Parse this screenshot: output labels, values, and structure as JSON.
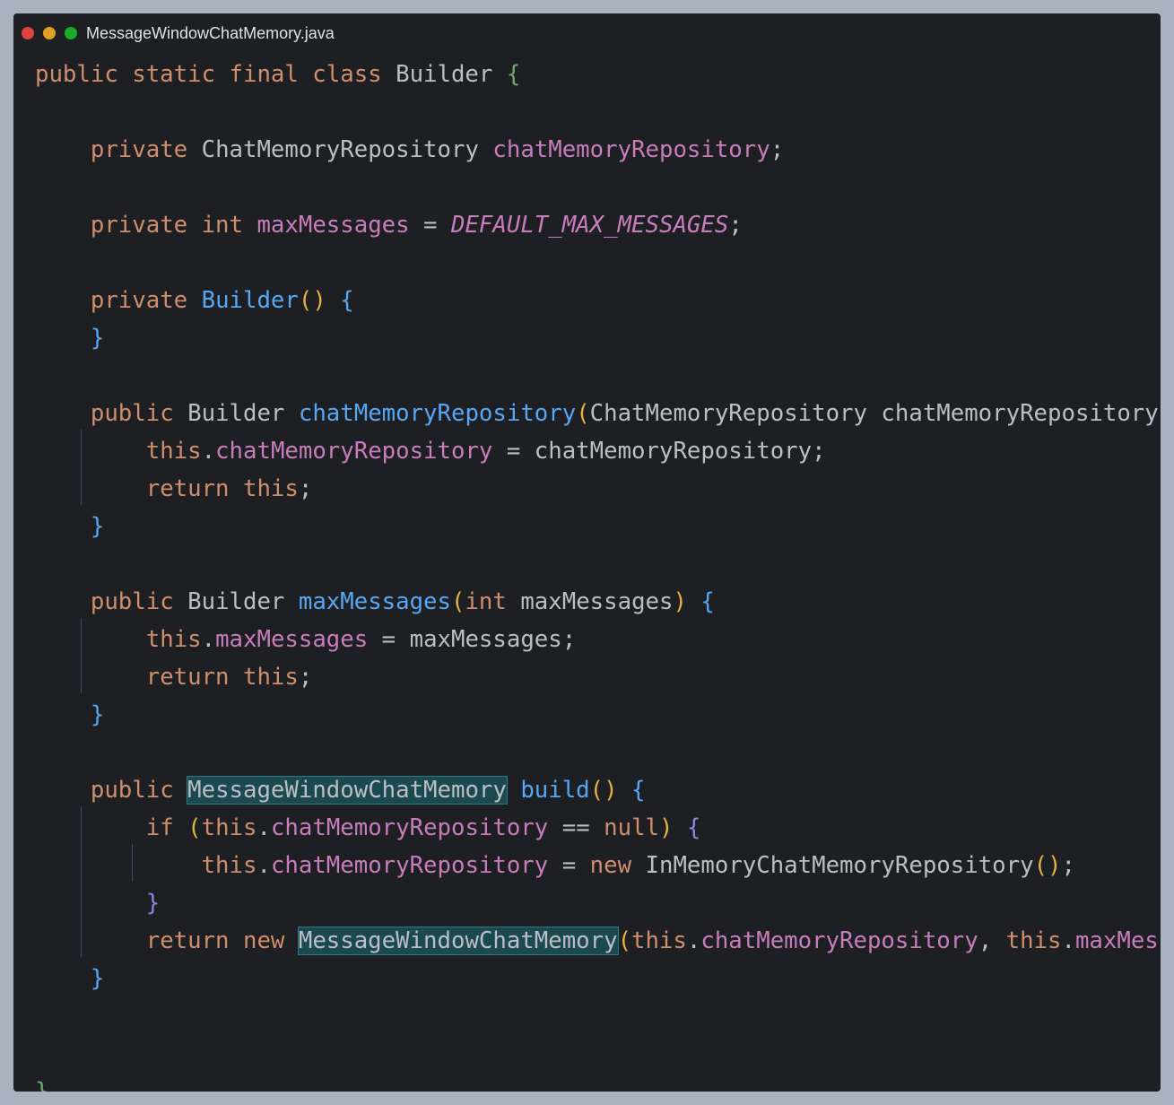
{
  "window": {
    "title": "MessageWindowChatMemory.java",
    "controls": [
      {
        "name": "close",
        "color": "#e0443e"
      },
      {
        "name": "minimize",
        "color": "#dea123"
      },
      {
        "name": "zoom",
        "color": "#1aab29"
      }
    ]
  },
  "code": {
    "language": "java",
    "lines": [
      [
        {
          "t": "public static final class ",
          "c": "kw"
        },
        {
          "t": "Builder "
        },
        {
          "t": "{",
          "c": "bg"
        }
      ],
      [],
      [
        {
          "t": "    "
        },
        {
          "t": "private ",
          "c": "kw"
        },
        {
          "t": "ChatMemoryRepository "
        },
        {
          "t": "chatMemoryRepository",
          "c": "fld"
        },
        {
          "t": ";"
        }
      ],
      [],
      [
        {
          "t": "    "
        },
        {
          "t": "private int ",
          "c": "kw"
        },
        {
          "t": "maxMessages",
          "c": "fld"
        },
        {
          "t": " = "
        },
        {
          "t": "DEFAULT_MAX_MESSAGES",
          "c": "const"
        },
        {
          "t": ";"
        }
      ],
      [],
      [
        {
          "t": "    "
        },
        {
          "t": "private ",
          "c": "kw"
        },
        {
          "t": "Builder",
          "c": "fn"
        },
        {
          "t": "()",
          "c": "py"
        },
        {
          "t": " "
        },
        {
          "t": "{",
          "c": "bl1"
        }
      ],
      [
        {
          "t": "    "
        },
        {
          "t": "}",
          "c": "bl1"
        }
      ],
      [],
      [
        {
          "t": "    "
        },
        {
          "t": "public ",
          "c": "kw"
        },
        {
          "t": "Builder "
        },
        {
          "t": "chatMemoryRepository",
          "c": "fn"
        },
        {
          "t": "(",
          "c": "py"
        },
        {
          "t": "ChatMemoryRepository chatMemoryRepository"
        },
        {
          "t": ")",
          "c": "py"
        },
        {
          "t": " "
        },
        {
          "t": "{",
          "c": "bl1"
        }
      ],
      [
        {
          "t": "        "
        },
        {
          "t": "this",
          "c": "kw"
        },
        {
          "t": "."
        },
        {
          "t": "chatMemoryRepository",
          "c": "fld"
        },
        {
          "t": " = chatMemoryRepository;"
        }
      ],
      [
        {
          "t": "        "
        },
        {
          "t": "return this",
          "c": "kw"
        },
        {
          "t": ";"
        }
      ],
      [
        {
          "t": "    "
        },
        {
          "t": "}",
          "c": "bl1"
        }
      ],
      [],
      [
        {
          "t": "    "
        },
        {
          "t": "public ",
          "c": "kw"
        },
        {
          "t": "Builder "
        },
        {
          "t": "maxMessages",
          "c": "fn"
        },
        {
          "t": "(",
          "c": "py"
        },
        {
          "t": "int ",
          "c": "kw"
        },
        {
          "t": "maxMessages"
        },
        {
          "t": ")",
          "c": "py"
        },
        {
          "t": " "
        },
        {
          "t": "{",
          "c": "bl1"
        }
      ],
      [
        {
          "t": "        "
        },
        {
          "t": "this",
          "c": "kw"
        },
        {
          "t": "."
        },
        {
          "t": "maxMessages",
          "c": "fld"
        },
        {
          "t": " = maxMessages;"
        }
      ],
      [
        {
          "t": "        "
        },
        {
          "t": "return this",
          "c": "kw"
        },
        {
          "t": ";"
        }
      ],
      [
        {
          "t": "    "
        },
        {
          "t": "}",
          "c": "bl1"
        }
      ],
      [],
      [
        {
          "t": "    "
        },
        {
          "t": "public ",
          "c": "kw"
        },
        {
          "t": "MessageWindowChatMemory",
          "c": "hl"
        },
        {
          "t": " "
        },
        {
          "t": "build",
          "c": "fn"
        },
        {
          "t": "()",
          "c": "py"
        },
        {
          "t": " "
        },
        {
          "t": "{",
          "c": "bl1"
        }
      ],
      [
        {
          "t": "        "
        },
        {
          "t": "if ",
          "c": "kw"
        },
        {
          "t": "(",
          "c": "py"
        },
        {
          "t": "this",
          "c": "kw"
        },
        {
          "t": "."
        },
        {
          "t": "chatMemoryRepository",
          "c": "fld"
        },
        {
          "t": " == "
        },
        {
          "t": "null",
          "c": "kw"
        },
        {
          "t": ")",
          "c": "py"
        },
        {
          "t": " "
        },
        {
          "t": "{",
          "c": "pv"
        }
      ],
      [
        {
          "t": "            "
        },
        {
          "t": "this",
          "c": "kw"
        },
        {
          "t": "."
        },
        {
          "t": "chatMemoryRepository",
          "c": "fld"
        },
        {
          "t": " = "
        },
        {
          "t": "new ",
          "c": "kw"
        },
        {
          "t": "InMemoryChatMemoryRepository"
        },
        {
          "t": "()",
          "c": "py"
        },
        {
          "t": ";"
        }
      ],
      [
        {
          "t": "        "
        },
        {
          "t": "}",
          "c": "pv"
        }
      ],
      [
        {
          "t": "        "
        },
        {
          "t": "return new ",
          "c": "kw"
        },
        {
          "t": "MessageWindowChatMemory",
          "c": "hl"
        },
        {
          "t": "(",
          "c": "py"
        },
        {
          "t": "this",
          "c": "kw"
        },
        {
          "t": "."
        },
        {
          "t": "chatMemoryRepository",
          "c": "fld"
        },
        {
          "t": ", "
        },
        {
          "t": "this",
          "c": "kw"
        },
        {
          "t": "."
        },
        {
          "t": "maxMessages",
          "c": "fld"
        },
        {
          "t": ")",
          "c": "py"
        },
        {
          "t": ";"
        }
      ],
      [
        {
          "t": "    "
        },
        {
          "t": "}",
          "c": "bl1"
        }
      ],
      [],
      [],
      [
        {
          "t": "}",
          "c": "bg"
        }
      ]
    ]
  }
}
